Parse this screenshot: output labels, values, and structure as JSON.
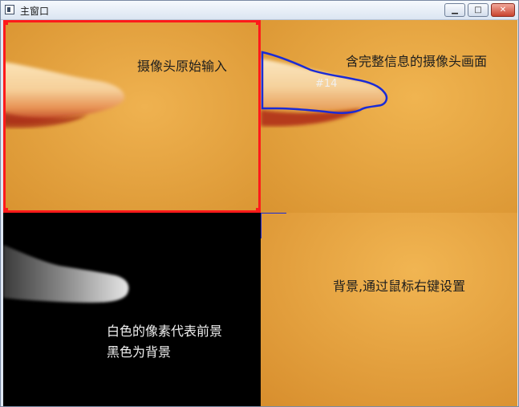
{
  "window": {
    "title": "主窗口",
    "minimize_glyph": "▁",
    "maximize_glyph": "□",
    "close_glyph": "✕"
  },
  "panes": {
    "raw_input": {
      "label": "摄像头原始输入"
    },
    "full_info": {
      "label": "含完整信息的摄像头画面",
      "blob_tag": "#14"
    },
    "foreground": {
      "label_line1": "白色的像素代表前景",
      "label_line2": "黑色为背景"
    },
    "background": {
      "label": "背景,通过鼠标右键设置"
    }
  },
  "colors": {
    "camera_orange": "#e8a440",
    "selection_red": "#ff1a1a",
    "contour_blue": "#1a2bd6",
    "foreground_bg": "#000000"
  },
  "icons": {
    "app": "window-app-icon",
    "minimize": "minimize-icon",
    "maximize": "maximize-icon",
    "close": "close-icon"
  }
}
